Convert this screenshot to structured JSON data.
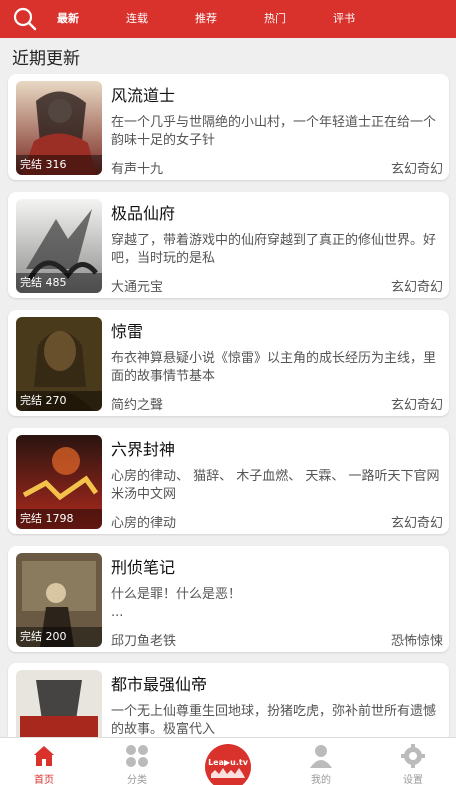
{
  "header": {
    "tabs": [
      {
        "label": "最新",
        "active": true
      },
      {
        "label": "连载",
        "active": false
      },
      {
        "label": "推荐",
        "active": false
      },
      {
        "label": "热门",
        "active": false
      },
      {
        "label": "评书",
        "active": false
      }
    ],
    "accent_color": "#d9312c",
    "search_icon": "search-icon"
  },
  "main": {
    "section_title": "近期更新",
    "books": [
      {
        "title": "风流道士",
        "description": "在一个几乎与世隔绝的小山村，一个年轻道士正在给一个韵味十足的女子针",
        "author": "有声十九",
        "genre": "玄幻奇幻",
        "status": "完结 316"
      },
      {
        "title": "极品仙府",
        "description": "穿越了，带着游戏中的仙府穿越到了真正的修仙世界。好吧，当时玩的是私",
        "author": "大通元宝",
        "genre": "玄幻奇幻",
        "status": "完结 485"
      },
      {
        "title": "惊雷",
        "description": "布衣神算悬疑小说《惊雷》以主角的成长经历为主线，里面的故事情节基本",
        "author": "简约之聲",
        "genre": "玄幻奇幻",
        "status": "完结 270"
      },
      {
        "title": "六界封神",
        "description": "心房的律动、 猫辞、 木子血燃、 天霖、 一路听天下官网米汤中文网",
        "author": "心房的律动",
        "genre": "玄幻奇幻",
        "status": "完结 1798"
      },
      {
        "title": "刑侦笔记",
        "description": "什么是罪！什么是恶！\n...",
        "author": "邱刀鱼老铁",
        "genre": "恐怖惊悚",
        "status": "完结 200"
      },
      {
        "title": "都市最强仙帝",
        "description": "一个无上仙尊重生回地球，扮猪吃虎，弥补前世所有遗憾的故事。极富代入",
        "author": "",
        "genre": "",
        "status": ""
      }
    ]
  },
  "bottom_nav": {
    "items": [
      {
        "label": "首页",
        "icon": "home-icon",
        "active": true
      },
      {
        "label": "分类",
        "icon": "category-icon",
        "active": false
      },
      {
        "label": "",
        "icon": "play-icon",
        "active": false
      },
      {
        "label": "我的",
        "icon": "user-icon",
        "active": false
      },
      {
        "label": "设置",
        "icon": "settings-icon",
        "active": false
      }
    ],
    "play_text": "Lea▶u.tv"
  }
}
